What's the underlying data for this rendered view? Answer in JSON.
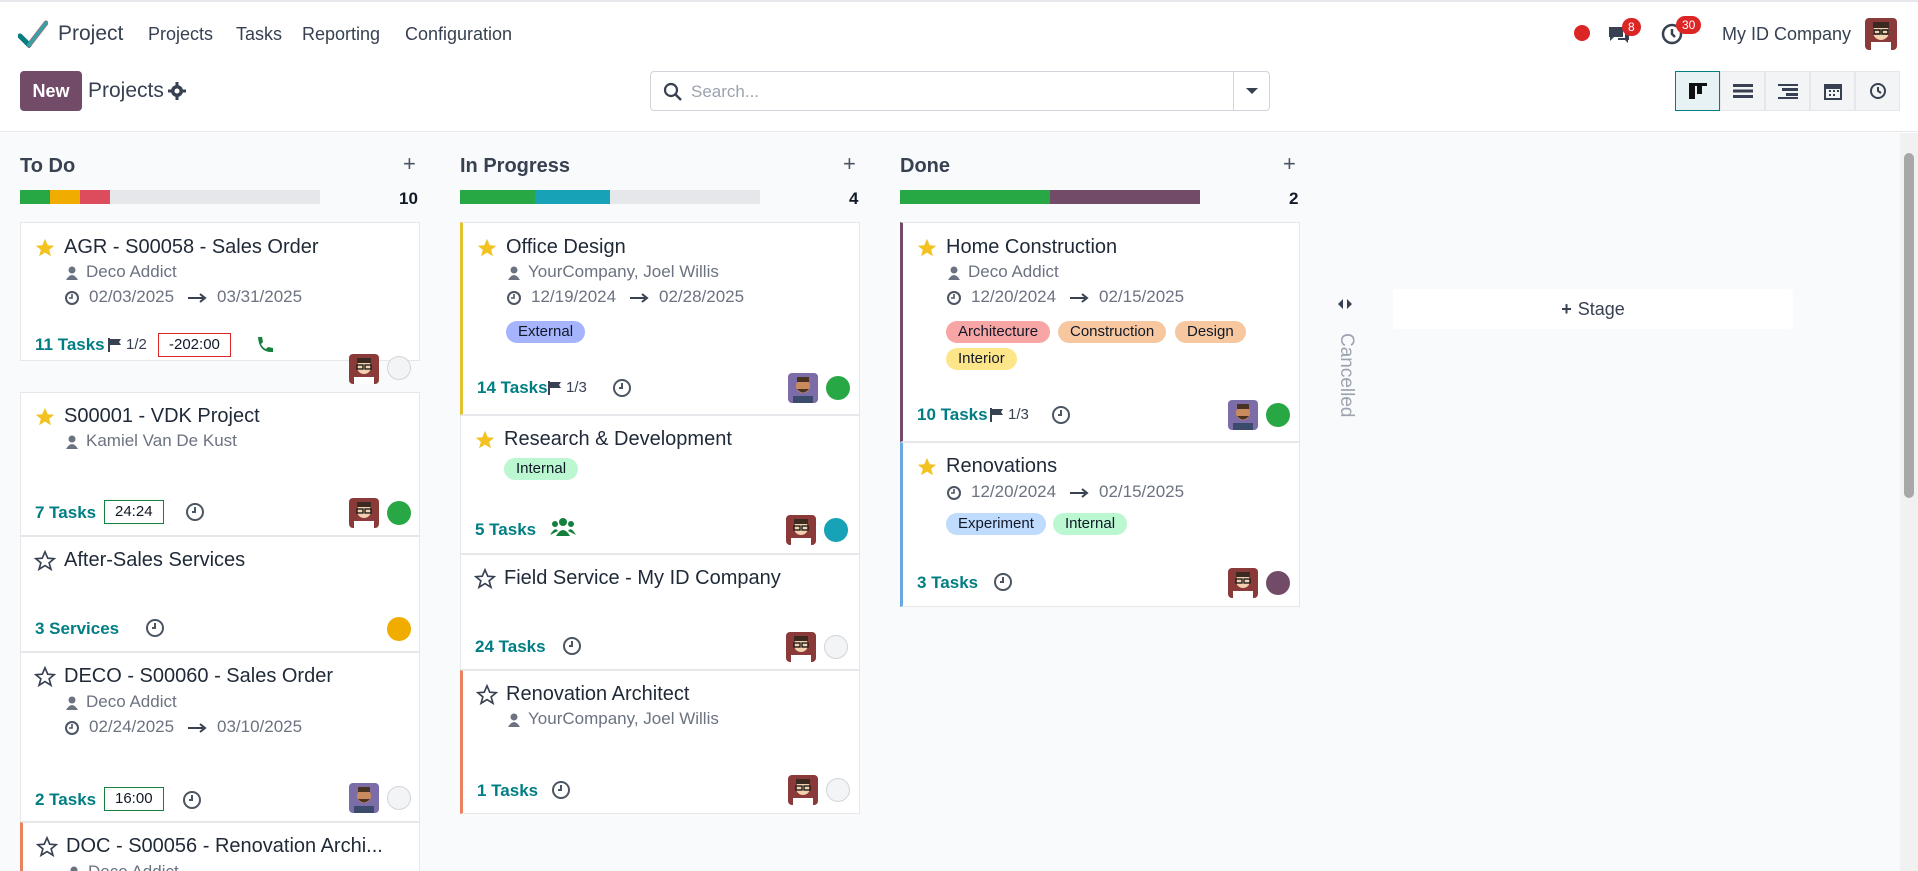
{
  "nav": {
    "app_name": "Project",
    "menu": [
      "Projects",
      "Tasks",
      "Reporting",
      "Configuration"
    ],
    "messages_badge": "8",
    "activities_badge": "30",
    "company": "My ID Company"
  },
  "control": {
    "new_label": "New",
    "breadcrumb": "Projects",
    "search_placeholder": "Search..."
  },
  "columns": [
    {
      "name": "To Do",
      "count": "10"
    },
    {
      "name": "In Progress",
      "count": "4"
    },
    {
      "name": "Done",
      "count": "2"
    }
  ],
  "progress": {
    "todo": [
      {
        "color": "#28a745",
        "frac": 0.1
      },
      {
        "color": "#f0ad00",
        "frac": 0.1
      },
      {
        "color": "#dc4c5c",
        "frac": 0.1
      }
    ],
    "inprogress": [
      {
        "color": "#28a745",
        "frac": 0.25
      },
      {
        "color": "#17a2b8",
        "frac": 0.25
      }
    ],
    "done": [
      {
        "color": "#28a745",
        "frac": 0.5
      },
      {
        "color": "#714B67",
        "frac": 0.5
      }
    ]
  },
  "cards": {
    "todo": [
      {
        "title": "AGR - S00058 - Sales Order",
        "customer": "Deco Addict",
        "start": "02/03/2025",
        "end": "03/31/2025",
        "tasks": "11 Tasks",
        "milestones": "1/2",
        "time": "-202:00"
      },
      {
        "title": "S00001 - VDK Project",
        "customer": "Kamiel Van De Kust",
        "tasks": "7 Tasks",
        "time": "24:24"
      },
      {
        "title": "After-Sales Services",
        "tasks": "3 Services"
      },
      {
        "title": "DECO - S00060 - Sales Order",
        "customer": "Deco Addict",
        "start": "02/24/2025",
        "end": "03/10/2025",
        "tasks": "2 Tasks",
        "time": "16:00"
      },
      {
        "title": "DOC - S00056 - Renovation Archi...",
        "customer": "Deco Addict"
      }
    ],
    "inprogress": [
      {
        "title": "Office Design",
        "customer": "YourCompany, Joel Willis",
        "start": "12/19/2024",
        "end": "02/28/2025",
        "tags": [
          "External"
        ],
        "tasks": "14 Tasks",
        "milestones": "1/3"
      },
      {
        "title": "Research & Development",
        "tags": [
          "Internal"
        ],
        "tasks": "5 Tasks"
      },
      {
        "title": "Field Service - My ID Company",
        "tasks": "24 Tasks"
      },
      {
        "title": "Renovation Architect",
        "customer": "YourCompany, Joel Willis",
        "tasks": "1 Tasks"
      }
    ],
    "done": [
      {
        "title": "Home Construction",
        "customer": "Deco Addict",
        "start": "12/20/2024",
        "end": "02/15/2025",
        "tags": [
          "Architecture",
          "Construction",
          "Design",
          "Interior"
        ],
        "tasks": "10 Tasks",
        "milestones": "1/3"
      },
      {
        "title": "Renovations",
        "start": "12/20/2024",
        "end": "02/15/2025",
        "tags": [
          "Experiment",
          "Internal"
        ],
        "tasks": "3 Tasks"
      }
    ]
  },
  "folded": {
    "name": "Cancelled"
  },
  "stage_button": "Stage",
  "colors": {
    "brand": "#714B67",
    "teal": "#017e84"
  }
}
